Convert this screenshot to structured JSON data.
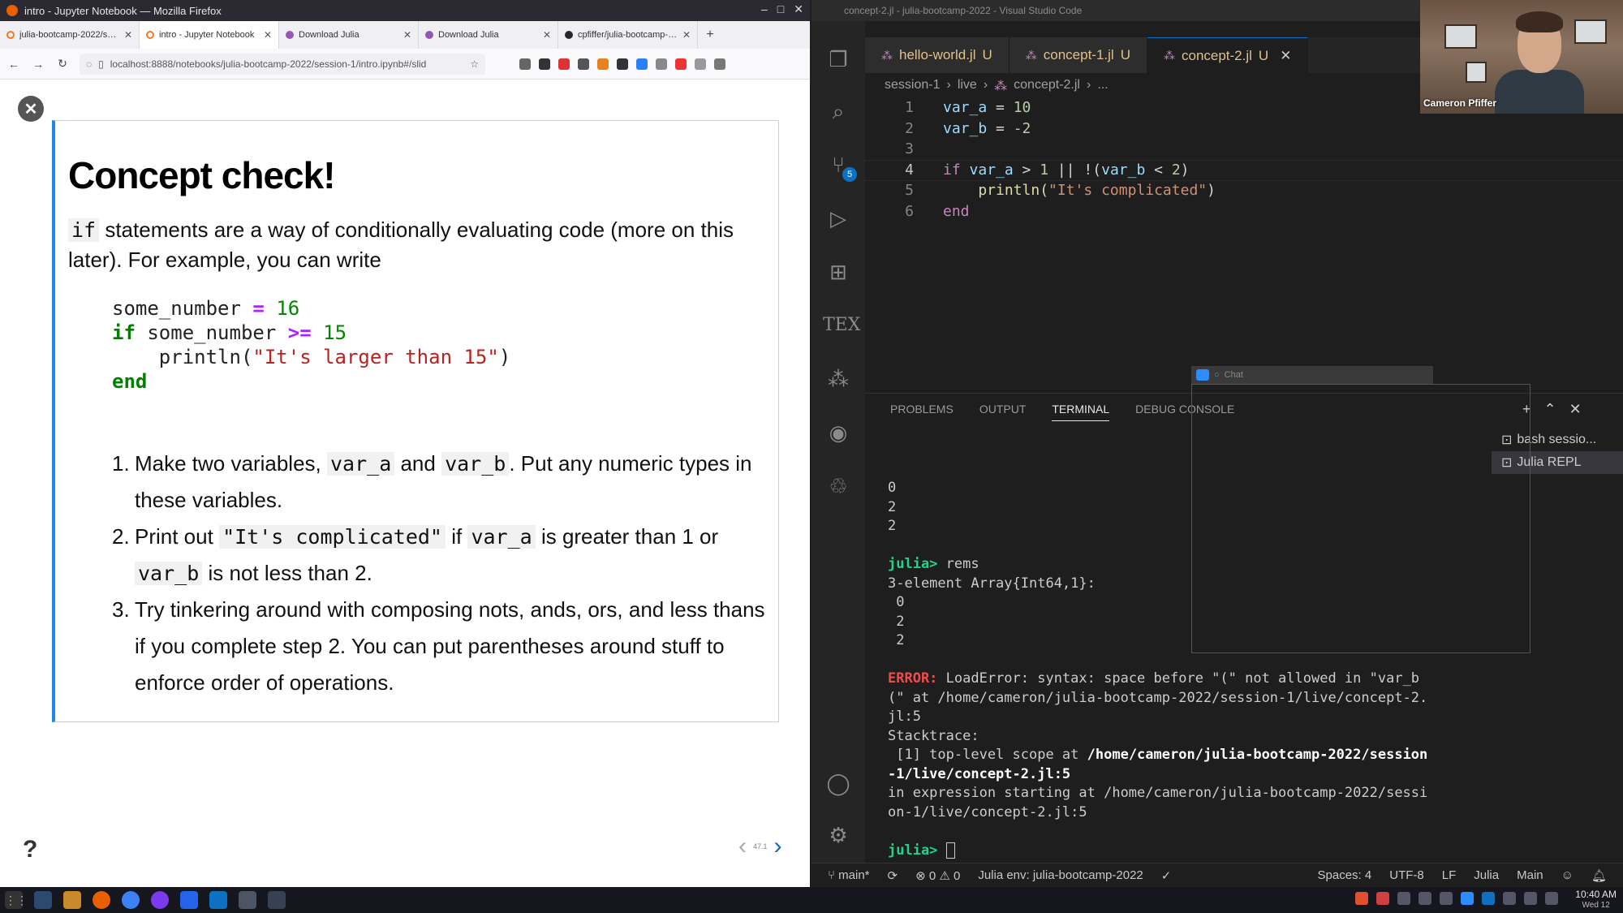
{
  "firefox": {
    "window_title": "intro - Jupyter Notebook — Mozilla Firefox",
    "tabs": [
      {
        "label": "julia-bootcamp-2022/sessi",
        "color": "#f37626"
      },
      {
        "label": "intro - Jupyter Notebook",
        "color": "#f37626"
      },
      {
        "label": "Download Julia",
        "color": "#9558b2"
      },
      {
        "label": "Download Julia",
        "color": "#9558b2"
      },
      {
        "label": "cpfiffer/julia-bootcamp-20",
        "color": "#24292e"
      }
    ],
    "url": "localhost:8888/notebooks/julia-bootcamp-2022/session-1/intro.ipynb#/slid"
  },
  "slide": {
    "title": "Concept check!",
    "intro_code": "if",
    "intro_text": " statements are a way of conditionally evaluating code (more on this later). For example, you can write",
    "code": {
      "l1_var": "some_number",
      "l1_op": "=",
      "l1_num": "16",
      "l2_kw": "if",
      "l2_var": "some_number",
      "l2_op": ">=",
      "l2_num": "15",
      "l3_fn": "println(",
      "l3_str": "\"It's larger than 15\"",
      "l3_close": ")",
      "l4_kw": "end"
    },
    "steps": {
      "s1_n": "1.",
      "s1_a": "Make two variables, ",
      "s1_c1": "var_a",
      "s1_b": " and ",
      "s1_c2": "var_b",
      "s1_d": ". Put any numeric types in these variables.",
      "s2_n": "2.",
      "s2_a": "Print out ",
      "s2_c1": "\"It's complicated\"",
      "s2_b": " if ",
      "s2_c2": "var_a",
      "s2_d": " is greater than 1 or ",
      "s2_c3": "var_b",
      "s2_e": " is not less than 2.",
      "s3_n": "3.",
      "s3_a": "Try tinkering around with composing nots, ands, ors, and less thans if you complete step 2. You can put parentheses around stuff to enforce order of operations."
    },
    "help": "?",
    "page_indicator": "47.1",
    "prev": "‹",
    "next": "›"
  },
  "vscode": {
    "window_title": "concept-2.jl - julia-bootcamp-2022 - Visual Studio Code",
    "tabs": [
      {
        "name": "hello-world.jl",
        "status": "U"
      },
      {
        "name": "concept-1.jl",
        "status": "U"
      },
      {
        "name": "concept-2.jl",
        "status": "U"
      }
    ],
    "breadcrumb": [
      "session-1",
      "›",
      "live",
      "›",
      "concept-2.jl",
      "›",
      "..."
    ],
    "scm_badge": "5",
    "line_numbers": [
      "1",
      "2",
      "3",
      "4",
      "5",
      "6"
    ],
    "code": {
      "l1a": "var_a",
      "l1b": " = ",
      "l1c": "10",
      "l2a": "var_b",
      "l2b": " = ",
      "l2c": "-2",
      "l4a": "if",
      "l4b": " var_a",
      "l4c": " > ",
      "l4d": "1",
      "l4e": " || !(",
      "l4f": "var_b",
      "l4g": " < ",
      "l4h": "2",
      "l4i": ")",
      "l5a": "    println(",
      "l5b": "\"It's complicated\"",
      "l5c": ")",
      "l6a": "end"
    },
    "chat_label": "Chat",
    "panel_tabs": [
      "PROBLEMS",
      "OUTPUT",
      "TERMINAL",
      "DEBUG CONSOLE"
    ],
    "terminals": [
      "bash sessio...",
      "Julia REPL"
    ],
    "terminal": {
      "o1": "0",
      "o2": "2",
      "o3": "2",
      "p1": "julia>",
      "c1": " rems",
      "r1": "3-element Array{Int64,1}:",
      "r2": " 0",
      "r3": " 2",
      "r4": " 2",
      "err_label": "ERROR:",
      "err_a": " LoadError: syntax: space before \"(\" not allowed in \"var_b",
      "err_b": "(\" at /home/cameron/julia-bootcamp-2022/session-1/live/concept-2.",
      "err_c": "jl:5",
      "st": "Stacktrace:",
      "st1a": " [1] top-level scope at ",
      "st1b": "/home/cameron/julia-bootcamp-2022/session",
      "st1c": "-1/live/concept-2.jl:5",
      "st2": "in expression starting at /home/cameron/julia-bootcamp-2022/sessi",
      "st3": "on-1/live/concept-2.jl:5",
      "p2": "julia>"
    },
    "status": {
      "branch": "main*",
      "errors": "⊗ 0 ⚠ 0",
      "env": "Julia env: julia-bootcamp-2022",
      "check": "✓",
      "spaces": "Spaces: 4",
      "encoding": "UTF-8",
      "eol": "LF",
      "lang": "Julia",
      "main": "Main"
    }
  },
  "webcam": {
    "name": "Cameron Pfiffer"
  },
  "taskbar": {
    "time": "10:40 AM",
    "date": "Wed 12"
  }
}
